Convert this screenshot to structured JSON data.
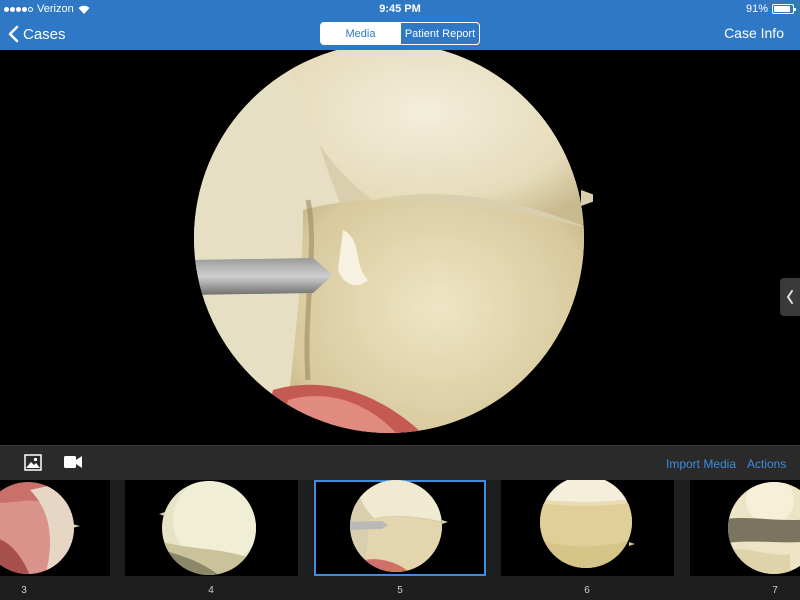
{
  "status_bar": {
    "carrier": "Verizon",
    "time": "9:45 PM",
    "battery": "91%",
    "battery_level": 0.91
  },
  "nav": {
    "back_label": "Cases",
    "tabs": [
      {
        "label": "Media",
        "active": true
      },
      {
        "label": "Patient Report",
        "active": false
      }
    ],
    "right_label": "Case Info"
  },
  "toolbar": {
    "icons": [
      "photo-icon",
      "video-camera-icon"
    ],
    "import_label": "Import Media",
    "actions_label": "Actions"
  },
  "thumbnails": [
    {
      "label": "3",
      "selected": false
    },
    {
      "label": "4",
      "selected": false
    },
    {
      "label": "5",
      "selected": true
    },
    {
      "label": "6",
      "selected": false
    },
    {
      "label": "7",
      "selected": false
    }
  ],
  "colors": {
    "accent": "#2e78c5",
    "link": "#3d8ce0",
    "toolbar_bg": "#2a2a2a"
  }
}
